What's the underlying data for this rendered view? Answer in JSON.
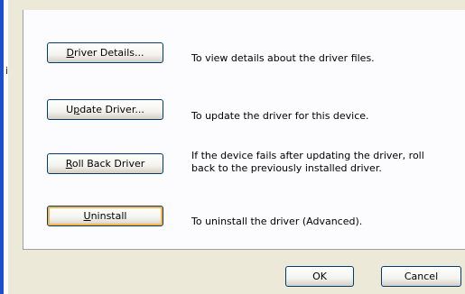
{
  "stray_text": "i",
  "driver_buttons": [
    {
      "label_first": "D",
      "label_rest": "river Details...",
      "description": "To view details about the driver files."
    },
    {
      "label_first": "U",
      "label_prefix": "U",
      "label_mnemonic": "p",
      "label_suffix": "date Driver...",
      "description": "To update the driver for this device."
    },
    {
      "label_first": "R",
      "label_rest": "oll Back Driver",
      "description_line1": "If the device fails after updating the driver, roll",
      "description_line2": "back to the previously installed driver."
    },
    {
      "label_first": "U",
      "label_rest": "ninstall",
      "description": "To uninstall the driver (Advanced)."
    }
  ],
  "footer": {
    "ok_label": "OK",
    "cancel_label": "Cancel"
  }
}
